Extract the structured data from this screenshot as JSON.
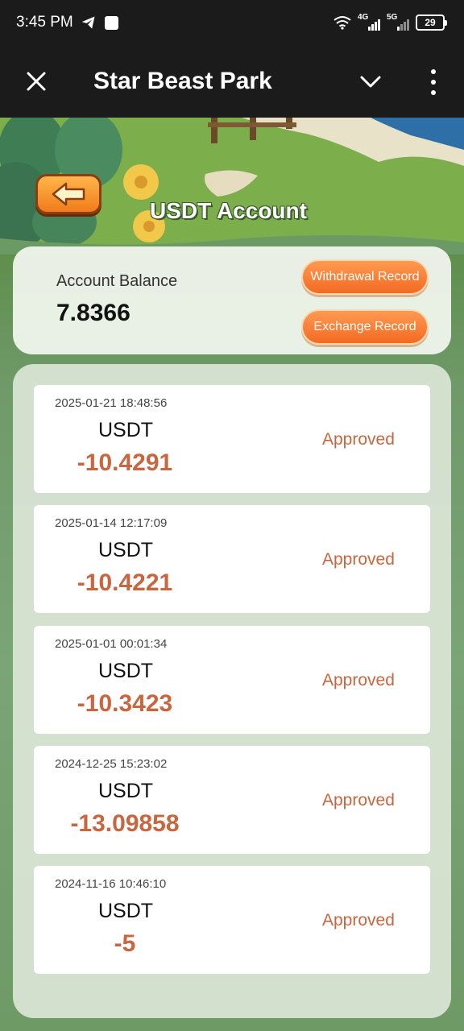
{
  "status_bar": {
    "time": "3:45 PM",
    "net1_label": "4G",
    "net2_label": "5G",
    "battery": "29"
  },
  "title_bar": {
    "title": "Star Beast Park"
  },
  "page": {
    "heading": "USDT Account"
  },
  "balance": {
    "label": "Account Balance",
    "value": "7.8366",
    "withdrawal_button": "Withdrawal Record",
    "exchange_button": "Exchange Record"
  },
  "records": [
    {
      "time": "2025-01-21 18:48:56",
      "currency": "USDT",
      "amount": "-10.4291",
      "status": "Approved"
    },
    {
      "time": "2025-01-14 12:17:09",
      "currency": "USDT",
      "amount": "-10.4221",
      "status": "Approved"
    },
    {
      "time": "2025-01-01 00:01:34",
      "currency": "USDT",
      "amount": "-10.3423",
      "status": "Approved"
    },
    {
      "time": "2024-12-25 15:23:02",
      "currency": "USDT",
      "amount": "-13.09858",
      "status": "Approved"
    },
    {
      "time": "2024-11-16 10:46:10",
      "currency": "USDT",
      "amount": "-5",
      "status": "Approved"
    }
  ],
  "colors": {
    "accent_orange": "#f36a22",
    "amount_color": "#c8663f"
  }
}
